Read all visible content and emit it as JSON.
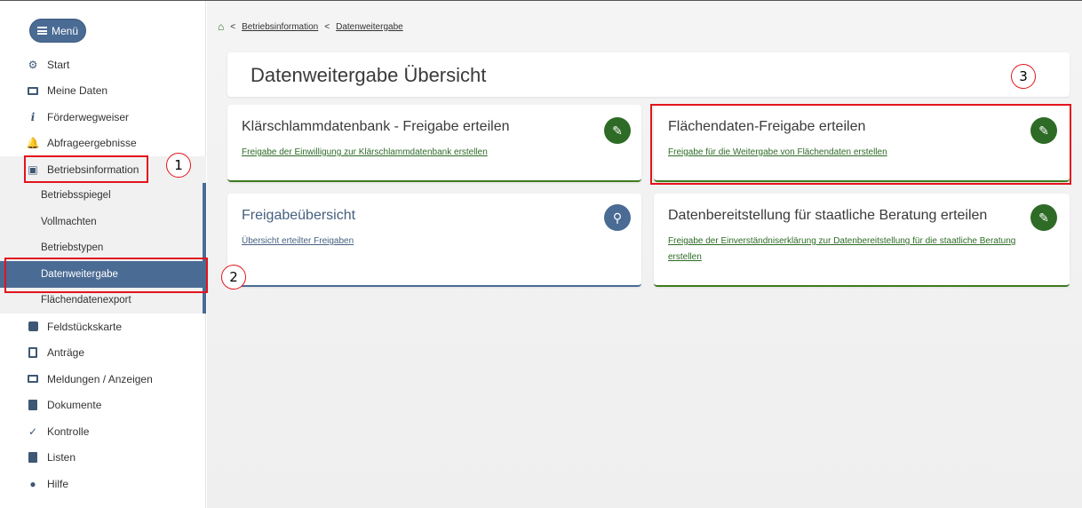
{
  "sidebar": {
    "menu_label": "Menü",
    "items": [
      {
        "label": "Start",
        "icon": "gear-icon"
      },
      {
        "label": "Meine Daten",
        "icon": "monitor-icon"
      },
      {
        "label": "Förderwegweiser",
        "icon": "info-icon"
      },
      {
        "label": "Abfrageergebnisse",
        "icon": "bell-icon"
      },
      {
        "label": "Betriebsinformation",
        "icon": "building-icon"
      }
    ],
    "sub_items": [
      {
        "label": "Betriebsspiegel"
      },
      {
        "label": "Vollmachten"
      },
      {
        "label": "Betriebstypen"
      },
      {
        "label": "Datenweitergabe"
      },
      {
        "label": "Flächendatenexport"
      }
    ],
    "items_after": [
      {
        "label": "Feldstückskarte",
        "icon": "map-icon"
      },
      {
        "label": "Anträge",
        "icon": "clipboard-icon"
      },
      {
        "label": "Meldungen / Anzeigen",
        "icon": "monitor-icon"
      },
      {
        "label": "Dokumente",
        "icon": "document-icon"
      },
      {
        "label": "Kontrolle",
        "icon": "checkmark-icon"
      },
      {
        "label": "Listen",
        "icon": "list-icon"
      },
      {
        "label": "Hilfe",
        "icon": "help-icon"
      }
    ]
  },
  "breadcrumb": {
    "sep": "<",
    "items": [
      "Betriebsinformation",
      "Datenweitergabe"
    ]
  },
  "page": {
    "title": "Datenweitergabe Übersicht"
  },
  "cards": [
    {
      "title": "Klärschlammdatenbank - Freigabe erteilen",
      "desc": "Freigabe der Einwilligung zur Klärschlammdatenbank erstellen",
      "action": "pencil-icon"
    },
    {
      "title": "Flächendaten-Freigabe erteilen",
      "desc": "Freigabe für die Weitergabe von Flächendaten erstellen",
      "action": "pencil-icon"
    },
    {
      "title": "Freigabeübersicht",
      "desc": "Übersicht erteilter Freigaben",
      "action": "search-icon"
    },
    {
      "title": "Datenbereitstellung für staatliche Beratung erteilen",
      "desc": "Freigabe der Einverständniserklärung zur Datenbereitstellung für die staatliche Beratung erstellen",
      "action": "pencil-icon"
    }
  ],
  "annotations": [
    "1",
    "2",
    "3"
  ],
  "colors": {
    "accent_blue": "#4a6b94",
    "accent_green": "#2e6b26",
    "annotation_red": "#e3141c"
  }
}
